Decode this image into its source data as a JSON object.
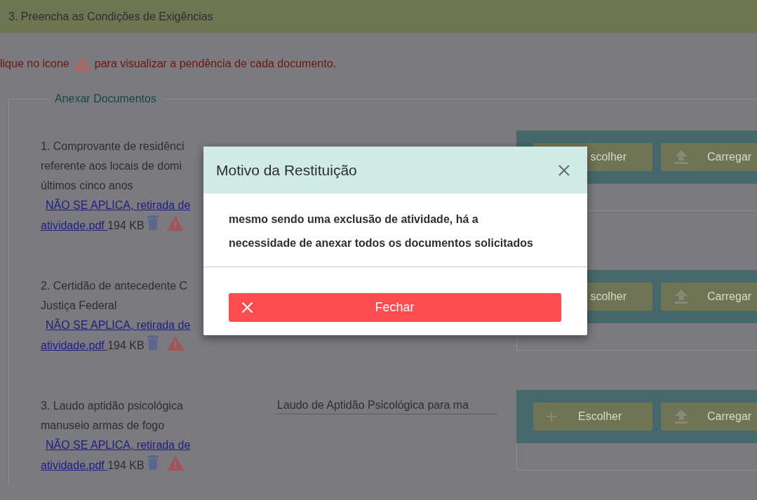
{
  "header": {
    "title": "3. Preencha as Condições de Exigências"
  },
  "hint": {
    "before": "lique no icone",
    "after": "para visualizar a pendência de cada documento."
  },
  "fieldset": {
    "legend": "Anexar Documentos"
  },
  "documents": [
    {
      "lines": [
        "1. Comprovante de residênci",
        "referente aos locais de domi",
        "últimos cinco anos"
      ],
      "link_lines": [
        "NÃO SE APLICA, retirada de",
        "atividade.pdf "
      ],
      "size": "194 KB",
      "buttons": [
        {
          "kind": "choose",
          "label": "scolher"
        },
        {
          "kind": "upload",
          "label": "Carregar"
        }
      ]
    },
    {
      "lines": [
        "2. Certidão de antecedente C",
        "Justiça Federal"
      ],
      "link_lines": [
        "NÃO SE APLICA, retirada de",
        "atividade.pdf "
      ],
      "size": "194 KB",
      "buttons": [
        {
          "kind": "choose",
          "label": "scolher"
        },
        {
          "kind": "upload",
          "label": "Carregar"
        }
      ]
    },
    {
      "lines": [
        "3. Laudo aptidão psicológica",
        "manuseio armas de fogo"
      ],
      "link_lines": [
        "NÃO SE APLICA, retirada de",
        "atividade.pdf "
      ],
      "size": "194 KB",
      "description": "Laudo de Aptidão Psicológica para ma",
      "buttons": [
        {
          "kind": "choose",
          "label": "Escolher"
        },
        {
          "kind": "upload",
          "label": "Carregar"
        }
      ]
    }
  ],
  "modal": {
    "title": "Motivo da Restituição",
    "message": "mesmo sendo uma exclusão de atividade, há a necessidade de anexar todos os documentos solicitados",
    "close_button": "Fechar"
  }
}
